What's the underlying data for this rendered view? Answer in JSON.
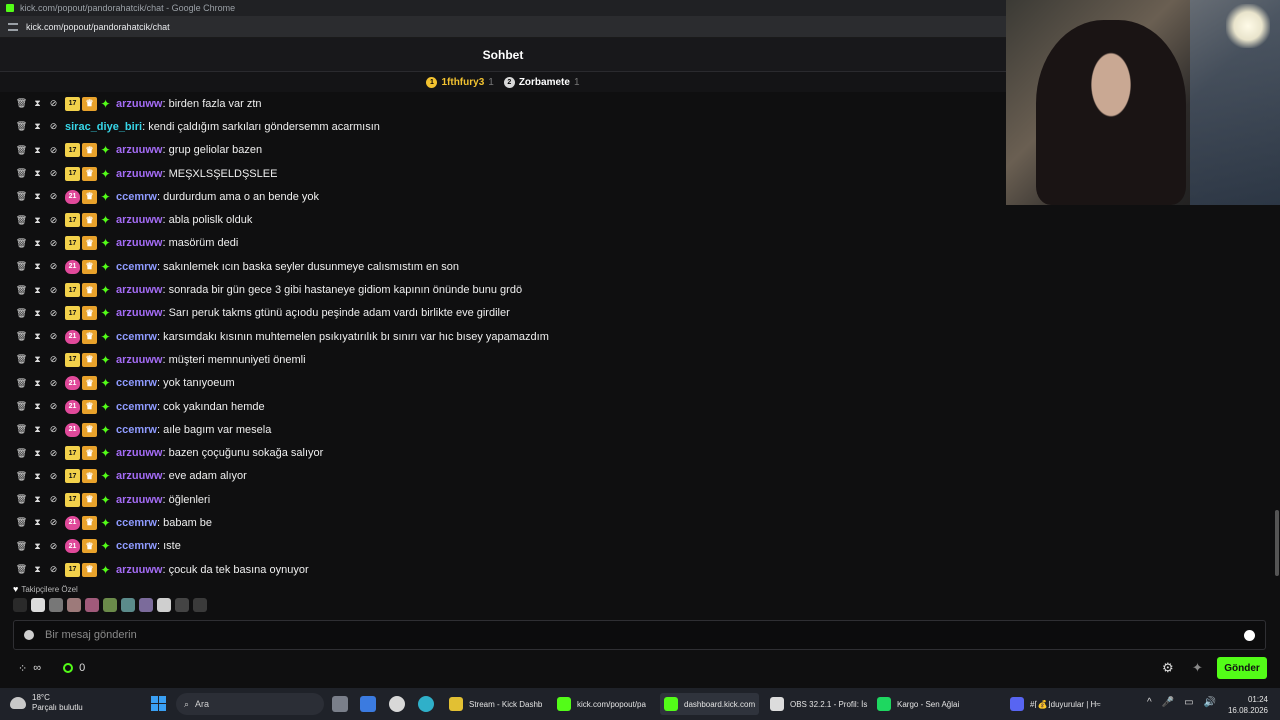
{
  "browser": {
    "window_title": "kick.com/popout/pandorahatcik/chat - Google Chrome",
    "url": "kick.com/popout/pandorahatcik/chat"
  },
  "chat": {
    "title": "Sohbet",
    "pinned_gifters": [
      {
        "rank": "1",
        "name": "1fthfury3",
        "count": "1",
        "color": "#f2c230",
        "name_color": "#f2c230"
      },
      {
        "rank": "2",
        "name": "Zorbamete",
        "count": "1",
        "color": "#d8d8d8",
        "name_color": "#ffffff"
      }
    ],
    "messages": [
      {
        "sub": "17",
        "user": "arzuuww",
        "color": "#a46cf5",
        "text": "birden fazla var ztn"
      },
      {
        "sub": "",
        "user": "sirac_diye_biri",
        "color": "#37d6e8",
        "text": "kendi çaldığım sarkıları göndersemm acarmısın"
      },
      {
        "sub": "17",
        "user": "arzuuww",
        "color": "#a46cf5",
        "text": "grup geliolar bazen"
      },
      {
        "sub": "17",
        "user": "arzuuww",
        "color": "#a46cf5",
        "text": "MEŞXLSŞELDŞSLEE"
      },
      {
        "sub": "21",
        "user": "ccemrw",
        "color": "#8f9bff",
        "text": "durdurdum ama o an bende yok"
      },
      {
        "sub": "17",
        "user": "arzuuww",
        "color": "#a46cf5",
        "text": "abla polislk olduk"
      },
      {
        "sub": "17",
        "user": "arzuuww",
        "color": "#a46cf5",
        "text": "masörüm dedi"
      },
      {
        "sub": "21",
        "user": "ccemrw",
        "color": "#8f9bff",
        "text": "sakınlemek ıcın baska seyler dusunmeye calısmıstım en son"
      },
      {
        "sub": "17",
        "user": "arzuuww",
        "color": "#a46cf5",
        "text": "sonrada bir gün gece 3 gibi hastaneye gidiom kapının önünde bunu grdö"
      },
      {
        "sub": "17",
        "user": "arzuuww",
        "color": "#a46cf5",
        "text": "Sarı peruk takms gtünü açıodu peşinde adam vardı birlikte eve girdiler"
      },
      {
        "sub": "21",
        "user": "ccemrw",
        "color": "#8f9bff",
        "text": "karsımdakı kısının muhtemelen psıkıyatırılık bı sınırı var hıc bısey yapamazdım"
      },
      {
        "sub": "17",
        "user": "arzuuww",
        "color": "#a46cf5",
        "text": "müşteri memnuniyeti önemli"
      },
      {
        "sub": "21",
        "user": "ccemrw",
        "color": "#8f9bff",
        "text": "yok tanıyoeum"
      },
      {
        "sub": "21",
        "user": "ccemrw",
        "color": "#8f9bff",
        "text": "cok yakından hemde"
      },
      {
        "sub": "21",
        "user": "ccemrw",
        "color": "#8f9bff",
        "text": "aıle bagım var mesela"
      },
      {
        "sub": "17",
        "user": "arzuuww",
        "color": "#a46cf5",
        "text": "bazen çoçuğunu sokağa salıyor"
      },
      {
        "sub": "17",
        "user": "arzuuww",
        "color": "#a46cf5",
        "text": "eve adam alıyor"
      },
      {
        "sub": "17",
        "user": "arzuuww",
        "color": "#a46cf5",
        "text": "öğlenleri"
      },
      {
        "sub": "21",
        "user": "ccemrw",
        "color": "#8f9bff",
        "text": "babam be"
      },
      {
        "sub": "21",
        "user": "ccemrw",
        "color": "#8f9bff",
        "text": "ıste"
      },
      {
        "sub": "17",
        "user": "arzuuww",
        "color": "#a46cf5",
        "text": "çocuk da tek basına oynuyor"
      }
    ],
    "followers_only_label": "Takipçilere Özel",
    "emote_count": 11,
    "input_placeholder": "Bir mesaj gönderin",
    "points_value": "0",
    "send_label": "Gönder",
    "accent_color": "#53fc18"
  },
  "taskbar": {
    "weather_temp": "18°C",
    "weather_desc": "Parçalı bulutlu",
    "search_label": "Ara",
    "apps": [
      {
        "label": "Stream - Kick Dashb",
        "icon": "chrome-icon"
      },
      {
        "label": "kick.com/popout/pa",
        "icon": "kick-icon"
      },
      {
        "label": "dashboard.kick.com",
        "icon": "kick-icon"
      },
      {
        "label": "OBS 32.2.1 - Profil: İs",
        "icon": "obs-icon"
      },
      {
        "label": "Kargo - Sen Ağlai",
        "icon": "spotify-icon"
      },
      {
        "label": "#⌈💰⌋duyurular | H≈",
        "icon": "discord-icon"
      }
    ],
    "time": "01:24",
    "date": "16.08.2026"
  }
}
